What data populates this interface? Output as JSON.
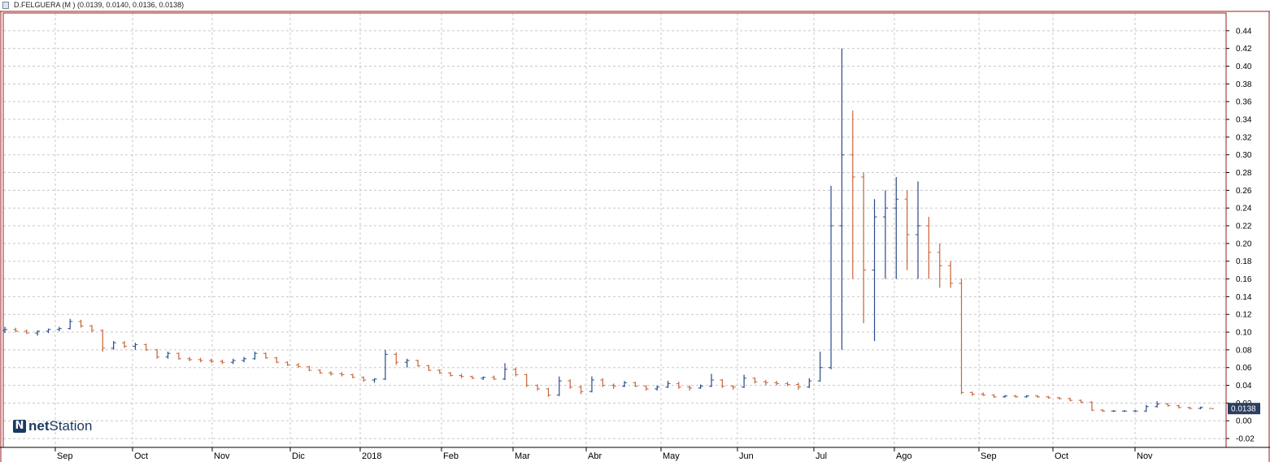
{
  "header": {
    "title": "D.FELGUERA (M ) (0.0139, 0.0140, 0.0136, 0.0138)"
  },
  "logo": {
    "text_bold": "net",
    "text_regular": "Station"
  },
  "colors": {
    "up": "#2a4a8a",
    "down": "#c8643a",
    "grid": "#c8c8c8",
    "frame": "#9b1c1c",
    "last_badge": "#2a3f5f"
  },
  "chart_data": {
    "type": "ohlc",
    "title": "D.FELGUERA (M ) (0.0139, 0.0140, 0.0136, 0.0138)",
    "xlabel": "",
    "ylabel": "",
    "ylim": [
      -0.03,
      0.46
    ],
    "grid": true,
    "y_ticks": [
      "0.44",
      "0.42",
      "0.40",
      "0.38",
      "0.36",
      "0.34",
      "0.32",
      "0.30",
      "0.28",
      "0.26",
      "0.24",
      "0.22",
      "0.20",
      "0.18",
      "0.16",
      "0.14",
      "0.12",
      "0.10",
      "0.08",
      "0.06",
      "0.04",
      "0.02",
      "0.00",
      "-0.02"
    ],
    "x_ticks": [
      "Sep",
      "Oct",
      "Nov",
      "Dic",
      "2018",
      "Feb",
      "Mar",
      "Abr",
      "May",
      "Jun",
      "Jul",
      "Ago",
      "Sep",
      "Oct",
      "Nov"
    ],
    "last_value": "0.0138",
    "series": [
      {
        "points": [
          [
            0.102,
            0.106,
            0.099,
            0.103
          ],
          [
            0.103,
            0.105,
            0.1,
            0.101
          ],
          [
            0.101,
            0.103,
            0.098,
            0.099
          ],
          [
            0.099,
            0.102,
            0.096,
            0.101
          ],
          [
            0.101,
            0.104,
            0.099,
            0.103
          ],
          [
            0.103,
            0.106,
            0.101,
            0.104
          ],
          [
            0.104,
            0.115,
            0.103,
            0.112
          ],
          [
            0.112,
            0.114,
            0.105,
            0.107
          ],
          [
            0.107,
            0.108,
            0.1,
            0.102
          ],
          [
            0.102,
            0.103,
            0.078,
            0.082
          ],
          [
            0.082,
            0.09,
            0.08,
            0.088
          ],
          [
            0.088,
            0.09,
            0.082,
            0.084
          ],
          [
            0.084,
            0.088,
            0.08,
            0.086
          ],
          [
            0.086,
            0.087,
            0.079,
            0.08
          ],
          [
            0.08,
            0.081,
            0.07,
            0.072
          ],
          [
            0.072,
            0.078,
            0.07,
            0.076
          ],
          [
            0.076,
            0.077,
            0.069,
            0.07
          ],
          [
            0.07,
            0.072,
            0.067,
            0.069
          ],
          [
            0.069,
            0.071,
            0.066,
            0.068
          ],
          [
            0.068,
            0.07,
            0.065,
            0.067
          ],
          [
            0.067,
            0.069,
            0.064,
            0.066
          ],
          [
            0.066,
            0.07,
            0.064,
            0.068
          ],
          [
            0.068,
            0.072,
            0.066,
            0.07
          ],
          [
            0.07,
            0.078,
            0.069,
            0.076
          ],
          [
            0.076,
            0.077,
            0.07,
            0.071
          ],
          [
            0.071,
            0.072,
            0.065,
            0.066
          ],
          [
            0.066,
            0.067,
            0.062,
            0.063
          ],
          [
            0.063,
            0.065,
            0.06,
            0.061
          ],
          [
            0.061,
            0.062,
            0.056,
            0.057
          ],
          [
            0.057,
            0.058,
            0.053,
            0.054
          ],
          [
            0.054,
            0.056,
            0.051,
            0.053
          ],
          [
            0.053,
            0.055,
            0.05,
            0.052
          ],
          [
            0.052,
            0.053,
            0.048,
            0.049
          ],
          [
            0.049,
            0.05,
            0.044,
            0.046
          ],
          [
            0.046,
            0.048,
            0.043,
            0.047
          ],
          [
            0.047,
            0.08,
            0.046,
            0.075
          ],
          [
            0.075,
            0.077,
            0.063,
            0.066
          ],
          [
            0.066,
            0.07,
            0.06,
            0.068
          ],
          [
            0.068,
            0.069,
            0.061,
            0.062
          ],
          [
            0.062,
            0.063,
            0.056,
            0.057
          ],
          [
            0.057,
            0.058,
            0.053,
            0.054
          ],
          [
            0.054,
            0.055,
            0.05,
            0.051
          ],
          [
            0.051,
            0.053,
            0.048,
            0.05
          ],
          [
            0.05,
            0.051,
            0.047,
            0.048
          ],
          [
            0.048,
            0.05,
            0.046,
            0.049
          ],
          [
            0.049,
            0.051,
            0.046,
            0.047
          ],
          [
            0.047,
            0.065,
            0.046,
            0.058
          ],
          [
            0.058,
            0.06,
            0.05,
            0.052
          ],
          [
            0.052,
            0.053,
            0.038,
            0.04
          ],
          [
            0.04,
            0.041,
            0.034,
            0.036
          ],
          [
            0.036,
            0.037,
            0.027,
            0.029
          ],
          [
            0.029,
            0.05,
            0.028,
            0.045
          ],
          [
            0.045,
            0.047,
            0.036,
            0.038
          ],
          [
            0.038,
            0.04,
            0.03,
            0.033
          ],
          [
            0.033,
            0.05,
            0.032,
            0.046
          ],
          [
            0.046,
            0.048,
            0.038,
            0.04
          ],
          [
            0.04,
            0.042,
            0.036,
            0.039
          ],
          [
            0.039,
            0.045,
            0.038,
            0.043
          ],
          [
            0.043,
            0.044,
            0.038,
            0.039
          ],
          [
            0.039,
            0.04,
            0.034,
            0.036
          ],
          [
            0.036,
            0.04,
            0.034,
            0.038
          ],
          [
            0.038,
            0.045,
            0.037,
            0.042
          ],
          [
            0.042,
            0.044,
            0.036,
            0.038
          ],
          [
            0.038,
            0.04,
            0.034,
            0.037
          ],
          [
            0.037,
            0.041,
            0.036,
            0.039
          ],
          [
            0.039,
            0.053,
            0.038,
            0.046
          ],
          [
            0.046,
            0.047,
            0.037,
            0.039
          ],
          [
            0.039,
            0.04,
            0.035,
            0.038
          ],
          [
            0.038,
            0.052,
            0.037,
            0.048
          ],
          [
            0.048,
            0.049,
            0.042,
            0.044
          ],
          [
            0.044,
            0.046,
            0.04,
            0.043
          ],
          [
            0.043,
            0.045,
            0.04,
            0.042
          ],
          [
            0.042,
            0.044,
            0.039,
            0.041
          ],
          [
            0.041,
            0.043,
            0.035,
            0.038
          ],
          [
            0.038,
            0.048,
            0.037,
            0.045
          ],
          [
            0.045,
            0.078,
            0.044,
            0.06
          ],
          [
            0.06,
            0.265,
            0.058,
            0.22
          ],
          [
            0.22,
            0.42,
            0.08,
            0.3
          ],
          [
            0.3,
            0.35,
            0.16,
            0.275
          ],
          [
            0.275,
            0.28,
            0.11,
            0.17
          ],
          [
            0.17,
            0.25,
            0.09,
            0.23
          ],
          [
            0.23,
            0.26,
            0.16,
            0.24
          ],
          [
            0.24,
            0.275,
            0.16,
            0.25
          ],
          [
            0.25,
            0.26,
            0.17,
            0.21
          ],
          [
            0.21,
            0.27,
            0.16,
            0.22
          ],
          [
            0.22,
            0.23,
            0.16,
            0.19
          ],
          [
            0.19,
            0.2,
            0.15,
            0.175
          ],
          [
            0.175,
            0.18,
            0.15,
            0.155
          ],
          [
            0.155,
            0.16,
            0.03,
            0.032
          ],
          [
            0.032,
            0.033,
            0.028,
            0.03
          ],
          [
            0.03,
            0.032,
            0.028,
            0.029
          ],
          [
            0.029,
            0.03,
            0.026,
            0.027
          ],
          [
            0.027,
            0.029,
            0.026,
            0.028
          ],
          [
            0.028,
            0.029,
            0.026,
            0.027
          ],
          [
            0.027,
            0.029,
            0.026,
            0.028
          ],
          [
            0.028,
            0.029,
            0.026,
            0.027
          ],
          [
            0.027,
            0.028,
            0.025,
            0.026
          ],
          [
            0.026,
            0.027,
            0.024,
            0.025
          ],
          [
            0.025,
            0.026,
            0.022,
            0.023
          ],
          [
            0.023,
            0.024,
            0.02,
            0.021
          ],
          [
            0.021,
            0.022,
            0.011,
            0.012
          ],
          [
            0.012,
            0.013,
            0.01,
            0.011
          ],
          [
            0.011,
            0.012,
            0.01,
            0.011
          ],
          [
            0.011,
            0.012,
            0.01,
            0.011
          ],
          [
            0.011,
            0.012,
            0.01,
            0.011
          ],
          [
            0.011,
            0.018,
            0.01,
            0.016
          ],
          [
            0.016,
            0.022,
            0.015,
            0.019
          ],
          [
            0.019,
            0.02,
            0.016,
            0.017
          ],
          [
            0.017,
            0.018,
            0.014,
            0.015
          ],
          [
            0.015,
            0.016,
            0.013,
            0.014
          ],
          [
            0.014,
            0.016,
            0.013,
            0.015
          ],
          [
            0.0139,
            0.014,
            0.0136,
            0.0138
          ]
        ]
      }
    ]
  }
}
